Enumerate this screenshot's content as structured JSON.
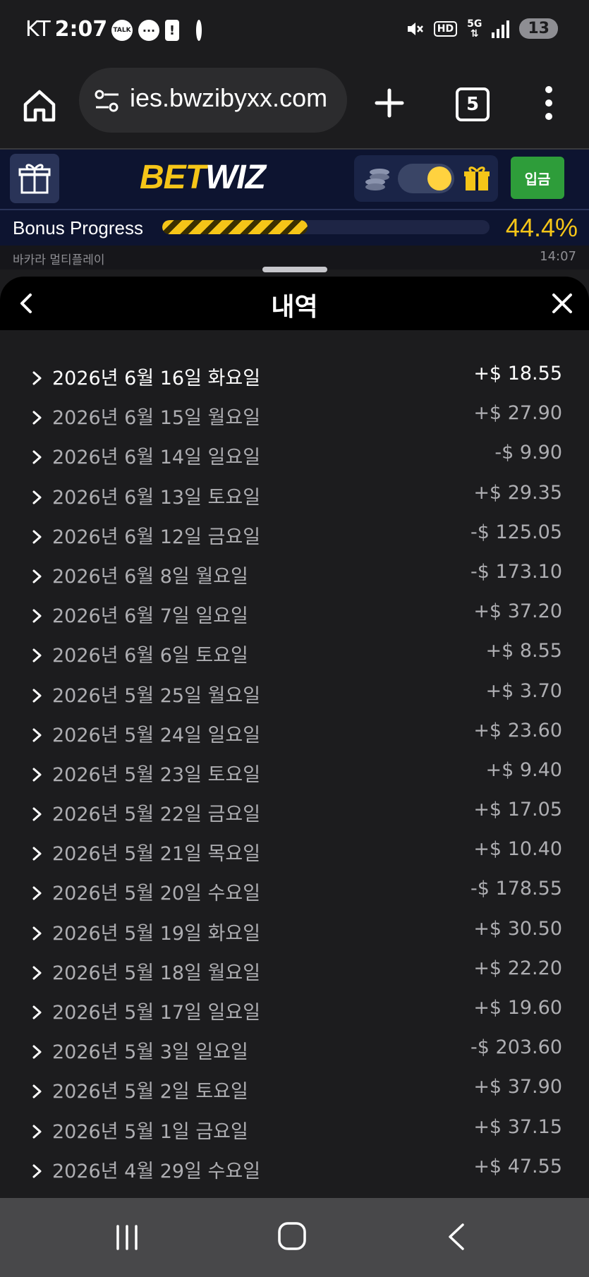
{
  "status_bar": {
    "carrier": "KT",
    "time": "2:07",
    "talk_label": "TALK",
    "hd_label": "HD",
    "network": "5G",
    "battery": "13"
  },
  "browser": {
    "url": "ies.bwzibyxx.com",
    "tab_count": "5"
  },
  "site": {
    "logo_bet": "BET",
    "logo_wiz": "WIZ",
    "deposit_label": "입금",
    "accent": "#f5c518"
  },
  "bonus": {
    "label": "Bonus Progress",
    "percent_text": "44.4%",
    "progress": 0.444
  },
  "game_row": {
    "name": "바카라 멀티플레이",
    "time": "14:07"
  },
  "sheet": {
    "title": "내역"
  },
  "history": [
    {
      "date": "2026년 6월 16일 화요일",
      "amount": "+$ 18.55"
    },
    {
      "date": "2026년 6월 15일 월요일",
      "amount": "+$ 27.90"
    },
    {
      "date": "2026년 6월 14일 일요일",
      "amount": "-$ 9.90"
    },
    {
      "date": "2026년 6월 13일 토요일",
      "amount": "+$ 29.35"
    },
    {
      "date": "2026년 6월 12일 금요일",
      "amount": "-$ 125.05"
    },
    {
      "date": "2026년 6월 8일 월요일",
      "amount": "-$ 173.10"
    },
    {
      "date": "2026년 6월 7일 일요일",
      "amount": "+$ 37.20"
    },
    {
      "date": "2026년 6월 6일 토요일",
      "amount": "+$ 8.55"
    },
    {
      "date": "2026년 5월 25일 월요일",
      "amount": "+$ 3.70"
    },
    {
      "date": "2026년 5월 24일 일요일",
      "amount": "+$ 23.60"
    },
    {
      "date": "2026년 5월 23일 토요일",
      "amount": "+$ 9.40"
    },
    {
      "date": "2026년 5월 22일 금요일",
      "amount": "+$ 17.05"
    },
    {
      "date": "2026년 5월 21일 목요일",
      "amount": "+$ 10.40"
    },
    {
      "date": "2026년 5월 20일 수요일",
      "amount": "-$ 178.55"
    },
    {
      "date": "2026년 5월 19일 화요일",
      "amount": "+$ 30.50"
    },
    {
      "date": "2026년 5월 18일 월요일",
      "amount": "+$ 22.20"
    },
    {
      "date": "2026년 5월 17일 일요일",
      "amount": "+$ 19.60"
    },
    {
      "date": "2026년 5월 3일 일요일",
      "amount": "-$ 203.60"
    },
    {
      "date": "2026년 5월 2일 토요일",
      "amount": "+$ 37.90"
    },
    {
      "date": "2026년 5월 1일 금요일",
      "amount": "+$ 37.15"
    },
    {
      "date": "2026년 4월 29일 수요일",
      "amount": "+$ 47.55"
    }
  ]
}
